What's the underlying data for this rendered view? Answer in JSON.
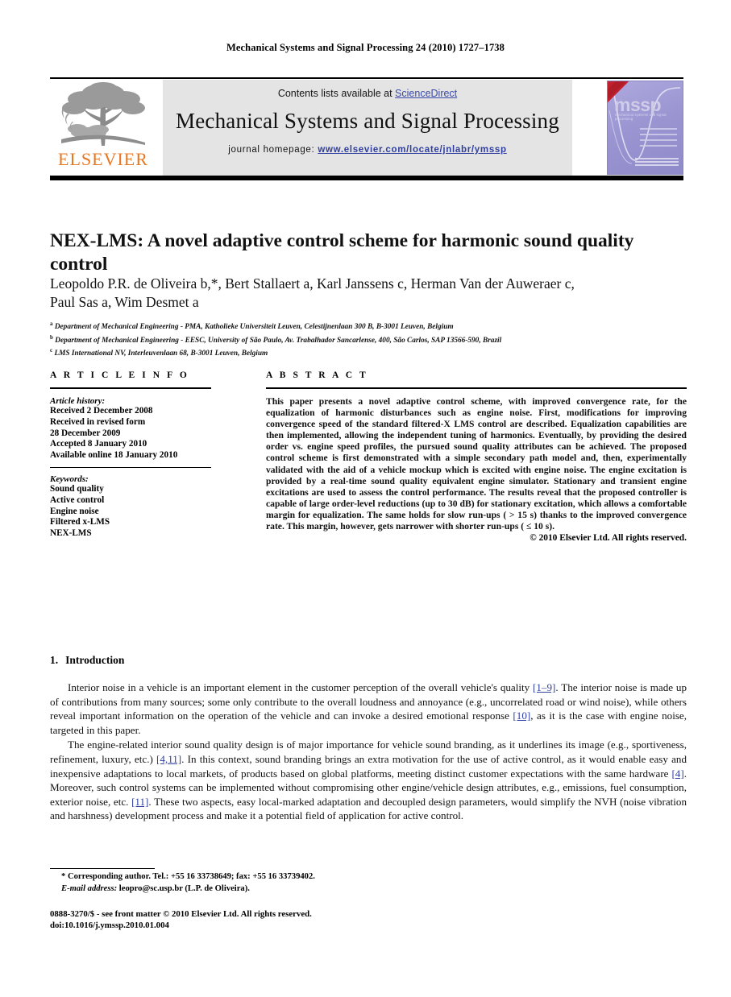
{
  "running_head": "Mechanical Systems and Signal Processing 24 (2010) 1727–1738",
  "masthead": {
    "contents_prefix": "Contents lists available at ",
    "sciencedirect": "ScienceDirect",
    "journal_name": "Mechanical Systems and Signal Processing",
    "homepage_prefix": "journal homepage: ",
    "homepage_url": "www.elsevier.com/locate/jnlabr/ymssp",
    "publisher_wordmark": "ELSEVIER",
    "cover_title": "mssp",
    "cover_subtitle": "mechanical systems and signal processing",
    "link_color": "#2f3fa0",
    "brand_color": "#e87722",
    "cover_bg_color": "#9b96d2",
    "banner_bg_color": "#e4e4e4"
  },
  "article": {
    "title": "NEX-LMS: A novel adaptive control scheme for harmonic sound quality control",
    "authors_line_1": "Leopoldo P.R. de Oliveira b,*, Bert Stallaert a, Karl Janssens c, Herman Van der Auweraer c,",
    "authors_line_2": "Paul Sas a, Wim Desmet a",
    "affiliations": [
      {
        "marker": "a",
        "text": "Department of Mechanical Engineering - PMA, Katholieke Universiteit Leuven, Celestijnenlaan 300 B, B-3001 Leuven, Belgium"
      },
      {
        "marker": "b",
        "text": "Department of Mechanical Engineering - EESC, University of São Paulo, Av. Trabalhador Sancarlense, 400, São Carlos, SAP 13566-590, Brazil"
      },
      {
        "marker": "c",
        "text": "LMS International NV, Interleuvenlaan 68, B-3001 Leuven, Belgium"
      }
    ]
  },
  "article_info": {
    "heading": "A R T I C L E   I N F O",
    "history_label": "Article history:",
    "history": [
      "Received 2 December 2008",
      "Received in revised form",
      "28 December 2009",
      "Accepted 8 January 2010",
      "Available online 18 January 2010"
    ],
    "keywords_label": "Keywords:",
    "keywords": [
      "Sound quality",
      "Active control",
      "Engine noise",
      "Filtered x-LMS",
      "NEX-LMS"
    ]
  },
  "abstract": {
    "heading": "A B S T R A C T",
    "text": "This paper presents a novel adaptive control scheme, with improved convergence rate, for the equalization of harmonic disturbances such as engine noise. First, modifications for improving convergence speed of the standard filtered-X LMS control are described. Equalization capabilities are then implemented, allowing the independent tuning of harmonics. Eventually, by providing the desired order vs. engine speed profiles, the pursued sound quality attributes can be achieved. The proposed control scheme is first demonstrated with a simple secondary path model and, then, experimentally validated with the aid of a vehicle mockup which is excited with engine noise. The engine excitation is provided by a real-time sound quality equivalent engine simulator. Stationary and transient engine excitations are used to assess the control performance. The results reveal that the proposed controller is capable of large order-level reductions (up to 30 dB) for stationary excitation, which allows a comfortable margin for equalization. The same holds for slow run-ups ( > 15 s) thanks to the improved convergence rate. This margin, however, gets narrower with shorter run-ups ( ≤ 10 s).",
    "copyright": "© 2010 Elsevier Ltd. All rights reserved."
  },
  "introduction": {
    "number": "1.",
    "heading": "Introduction",
    "paragraph_1_part_1": "Interior noise in a vehicle is an important element in the customer perception of the overall vehicle's quality ",
    "paragraph_1_ref_1": "[1–9]",
    "paragraph_1_part_2": ". The interior noise is made up of contributions from many sources; some only contribute to the overall loudness and annoyance (e.g., uncorrelated road or wind noise), while others reveal important information on the operation of the vehicle and can invoke a desired emotional response ",
    "paragraph_1_ref_2": "[10]",
    "paragraph_1_part_3": ", as it is the case with engine noise, targeted in this paper.",
    "paragraph_2_part_1": "The engine-related interior sound quality design is of major importance for vehicle sound branding, as it underlines its image (e.g., sportiveness, refinement, luxury, etc.) ",
    "paragraph_2_ref_1": "[4,11]",
    "paragraph_2_part_2": ". In this context, sound branding brings an extra motivation for the use of active control, as it would enable easy and inexpensive adaptations to local markets, of products based on global platforms, meeting distinct customer expectations with the same hardware ",
    "paragraph_2_ref_2": "[4]",
    "paragraph_2_part_3": ". Moreover, such control systems can be implemented without compromising other engine/vehicle design attributes, e.g., emissions, fuel consumption, exterior noise, etc. ",
    "paragraph_2_ref_3": "[11]",
    "paragraph_2_part_4": ". These two aspects, easy local-marked adaptation and decoupled design parameters, would simplify the NVH (noise vibration and harshness) development process and make it a potential field of application for active control."
  },
  "footnotes": {
    "corresponding": "* Corresponding author. Tel.: +55 16 33738649; fax: +55 16 33739402.",
    "email_label": "E-mail address:",
    "email_value": " leopro@sc.usp.br (L.P. de Oliveira).",
    "imprint_line_1": "0888-3270/$ - see front matter © 2010 Elsevier Ltd. All rights reserved.",
    "imprint_line_2": "doi:10.1016/j.ymssp.2010.01.004"
  }
}
